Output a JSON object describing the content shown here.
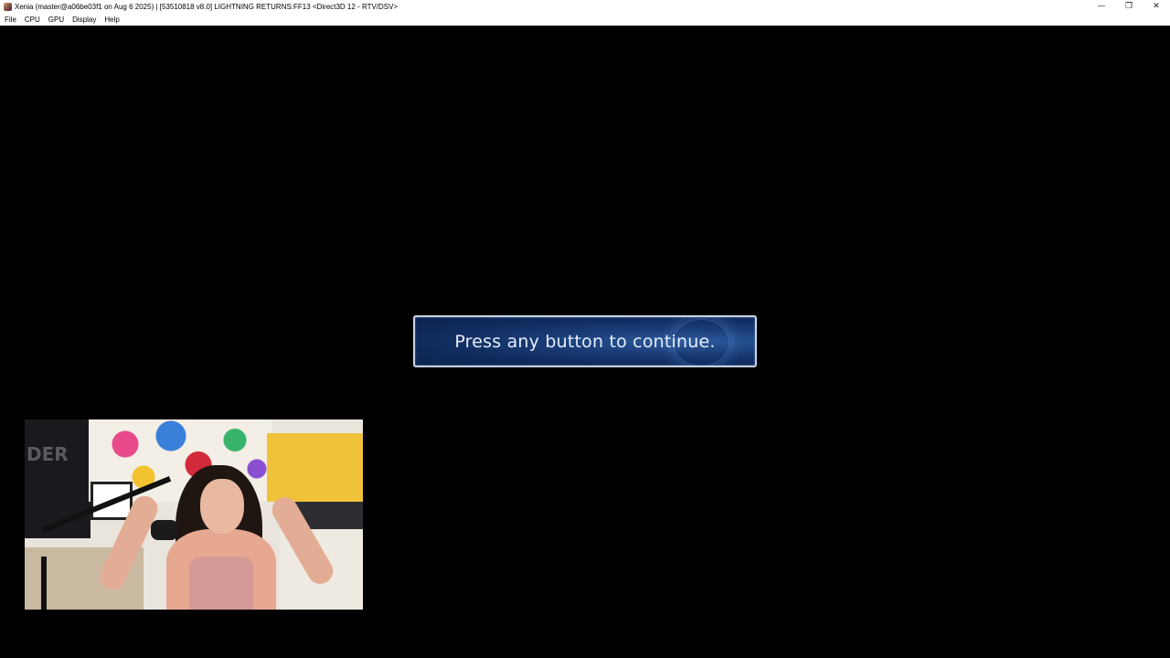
{
  "window": {
    "title": "Xenia (master@a06be03f1 on Aug  6 2025) | [53510818 v8.0] LIGHTNING RETURNS:FF13 <Direct3D 12 - RTV/DSV>",
    "controls": {
      "minimize": "—",
      "restore": "❐",
      "close": "✕"
    }
  },
  "menubar": {
    "items": [
      {
        "label": "File"
      },
      {
        "label": "CPU"
      },
      {
        "label": "GPU"
      },
      {
        "label": "Display"
      },
      {
        "label": "Help"
      }
    ]
  },
  "game": {
    "prompt_text": "Press any button to continue.",
    "prompt_colors": {
      "fill": "#0f2a5c",
      "border": "#c9d4e4",
      "text": "#e8eef8"
    }
  },
  "webcam": {
    "panel_text": "DER"
  },
  "icons": {
    "app": "xenia-app-icon",
    "minimize": "minimize-icon",
    "restore": "restore-icon",
    "close": "close-icon"
  }
}
